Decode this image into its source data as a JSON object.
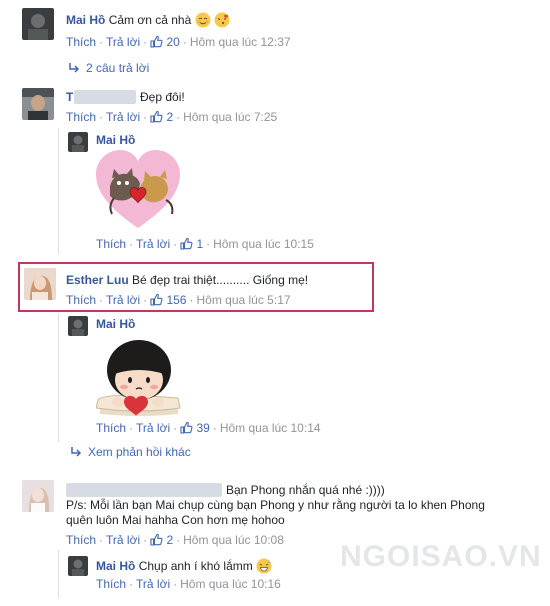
{
  "comments": [
    {
      "author": "Mai Hồ",
      "text": "Cảm ơn cả nhà",
      "emoji": "blush-emoji,kiss-emoji",
      "like_label": "Thích",
      "reply_label": "Trả lời",
      "likes": "20",
      "time": "Hôm qua lúc 12:37",
      "replies_link": "2 câu trả lời"
    },
    {
      "author": "T",
      "text": "Đẹp đôi!",
      "like_label": "Thích",
      "reply_label": "Trả lời",
      "likes": "2",
      "time": "Hôm qua lúc 7:25",
      "reply": {
        "author": "Mai Hồ",
        "sticker": "hugging-cats-heart-sticker",
        "like_label": "Thích",
        "reply_label": "Trả lời",
        "likes": "1",
        "time": "Hôm qua lúc 10:15"
      }
    },
    {
      "author": "Esther Luu",
      "text": "Bé đẹp trai thiệt.......... Giống mẹ!",
      "like_label": "Thích",
      "reply_label": "Trả lời",
      "likes": "156",
      "time": "Hôm qua lúc 5:17",
      "highlight_color": "#c0395b",
      "reply": {
        "author": "Mai Hồ",
        "sticker": "girl-with-heart-sticker",
        "like_label": "Thích",
        "reply_label": "Trả lời",
        "likes": "39",
        "time": "Hôm qua lúc 10:14"
      },
      "more_replies": "Xem phản hồi khác"
    },
    {
      "author_suffix": "Bạn Phong nhắn quá nhé :))))",
      "text_line1": "P/s: Mỗi lần bạn Mai chụp cùng bạn Phong y như rằng người ta lo khen Phong",
      "text_line2": "quên luôn Mai hahha Con hơn mẹ hohoo",
      "like_label": "Thích",
      "reply_label": "Trả lời",
      "likes": "2",
      "time": "Hôm qua lúc 10:08",
      "reply": {
        "author": "Mai Hồ",
        "text": "Chụp anh í khó lắmm",
        "emoji": "grin-sweat-emoji",
        "like_label": "Thích",
        "reply_label": "Trả lời",
        "time": "Hôm qua lúc 10:16"
      }
    }
  ],
  "watermark": "NGOISAO.VN",
  "colors": {
    "link": "#4267b2",
    "name": "#365899",
    "meta": "#90949c",
    "highlight": "#c0395b"
  }
}
